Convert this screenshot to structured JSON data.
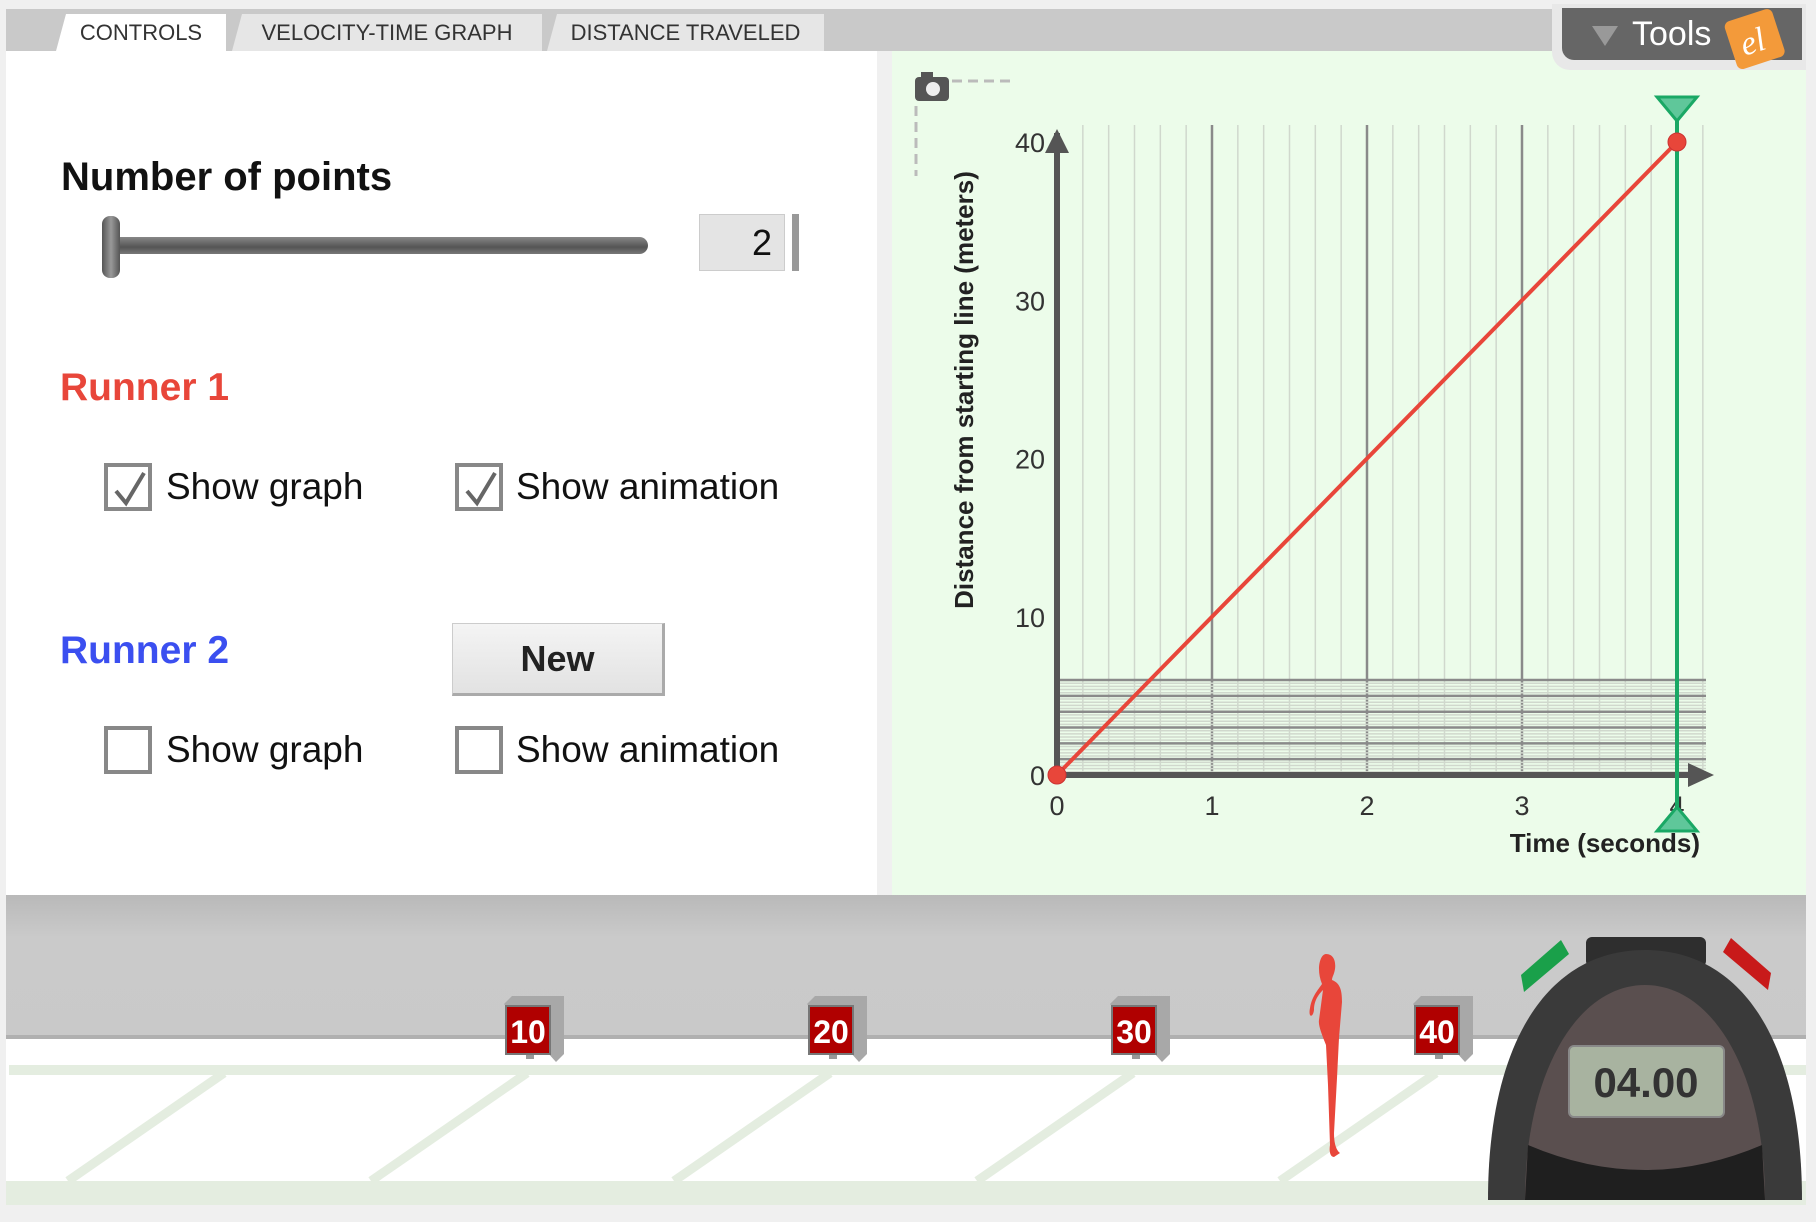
{
  "tabs": [
    {
      "label": "CONTROLS",
      "active": true
    },
    {
      "label": "VELOCITY-TIME GRAPH",
      "active": false
    },
    {
      "label": "DISTANCE TRAVELED",
      "active": false
    }
  ],
  "tools": {
    "label": "Tools",
    "icon": "triangle-down-icon",
    "logo_text": "el"
  },
  "controls": {
    "number_of_points": {
      "label": "Number of points",
      "value": "2",
      "slider_fraction": 0
    },
    "runner1": {
      "label": "Runner 1",
      "color": "#e8463a",
      "show_graph": {
        "label": "Show graph",
        "checked": true
      },
      "show_animation": {
        "label": "Show animation",
        "checked": true
      }
    },
    "runner2": {
      "label": "Runner 2",
      "color": "#3b4ff0",
      "new_label": "New",
      "show_graph": {
        "label": "Show graph",
        "checked": false
      },
      "show_animation": {
        "label": "Show animation",
        "checked": false
      }
    }
  },
  "chart_data": {
    "type": "line",
    "xlabel": "Time (seconds)",
    "ylabel": "Distance from starting line (meters)",
    "xlim": [
      0,
      4
    ],
    "ylim": [
      0,
      40
    ],
    "xticks": [
      "0",
      "1",
      "2",
      "3",
      "4"
    ],
    "yticks": [
      "0",
      "10",
      "20",
      "30",
      "40"
    ],
    "grid": true,
    "series": [
      {
        "color": "#e8463a",
        "x": [
          0,
          4
        ],
        "y": [
          0,
          40
        ]
      }
    ],
    "time_cursor": 4,
    "cursor_color": "#1aa865"
  },
  "track": {
    "markers": [
      "10",
      "20",
      "30",
      "40"
    ],
    "runner_position_m": 35
  },
  "stopwatch": {
    "display": "04.00"
  }
}
